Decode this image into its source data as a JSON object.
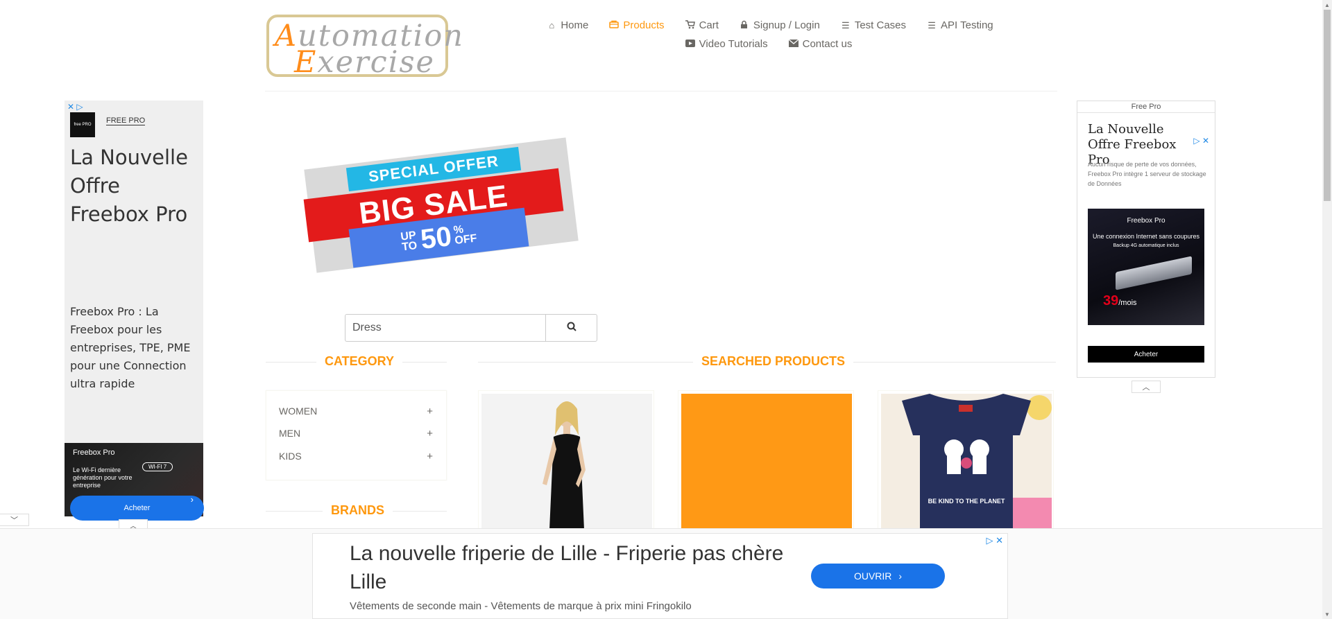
{
  "logo": {
    "line1_cap": "A",
    "line1_rest": "utomation",
    "line2_cap": "E",
    "line2_rest": "xercise"
  },
  "nav": {
    "row1": [
      {
        "label": "Home",
        "icon": "home-icon"
      },
      {
        "label": "Products",
        "icon": "shopping-bag-icon",
        "active": true
      },
      {
        "label": "Cart",
        "icon": "cart-icon"
      },
      {
        "label": "Signup / Login",
        "icon": "lock-icon"
      },
      {
        "label": "Test Cases",
        "icon": "list-icon"
      },
      {
        "label": "API Testing",
        "icon": "list-icon"
      }
    ],
    "row2": [
      {
        "label": "Video Tutorials",
        "icon": "youtube-icon"
      },
      {
        "label": "Contact us",
        "icon": "envelope-icon"
      }
    ]
  },
  "left_ad": {
    "brand": "FREE PRO",
    "logo_text": "free PRO",
    "title": "La Nouvelle Offre Freebox Pro",
    "text": "Freebox Pro : La Freebox pour les entreprises, TPE, PME pour une Connection ultra rapide",
    "banner": {
      "title": "Freebox Pro",
      "text": "Le Wi-Fi dernière génération pour votre entreprise",
      "badge": "WI-FI 7",
      "cta": "Acheter"
    }
  },
  "right_ad": {
    "label": "Free Pro",
    "title": "La Nouvelle Offre Freebox Pro",
    "text": "Aucun risque de perte de vos données, Freebox Pro intègre 1 serveur de stockage de Données",
    "image": {
      "title": "Freebox Pro",
      "subtitle": "Une connexion Internet sans coupures",
      "subtitle2": "Backup 4G automatique inclus",
      "price": "39",
      "price_unit": "/mois"
    },
    "cta": "Acheter"
  },
  "sale": {
    "top": "SPECIAL OFFER",
    "middle": "BIG SALE",
    "upto": "UP",
    "to": "TO",
    "percent": "50",
    "pct_sign": "%",
    "off": "OFF"
  },
  "search": {
    "value": "Dress"
  },
  "sections": {
    "category": "CATEGORY",
    "searched": "SEARCHED PRODUCTS",
    "brands": "BRANDS"
  },
  "categories": [
    "WOMEN",
    "MEN",
    "KIDS"
  ],
  "products": [
    {
      "image": "woman-black-dress"
    },
    {
      "image": "orange-placeholder"
    },
    {
      "image": "kids-navy-top",
      "caption": "BE KIND TO THE PLANET"
    }
  ],
  "bottom_ad": {
    "title": "La nouvelle friperie de Lille - Friperie pas chère Lille",
    "desc": "Vêtements de seconde main - Vêtements de marque à prix mini Fringokilo",
    "cta": "OUVRIR"
  },
  "colors": {
    "accent": "#fe980f",
    "text": "#696763",
    "ad_blue": "#1a73e8"
  }
}
